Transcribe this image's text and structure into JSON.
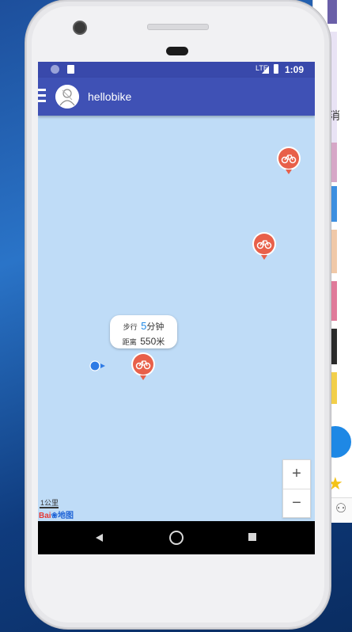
{
  "app": {
    "title": "hellobike"
  },
  "status_bar": {
    "time": "1:09",
    "network": "LTE"
  },
  "map": {
    "marker_icon": "bike-marker-icon",
    "marker_color": "#e8604a",
    "user_location_color": "#2f7be5",
    "popup": {
      "walk_label": "步行",
      "walk_value": "5",
      "walk_unit": "分钟",
      "distance_label": "距离",
      "distance_value": "550",
      "distance_unit": "米"
    },
    "scale_label": "1公里",
    "logo_text_red": "Bai",
    "logo_text_blue": "地图",
    "zoom_in_label": "+",
    "zoom_out_label": "−"
  },
  "colors": {
    "app_bar": "#3f51b5",
    "status_bar": "#3949ab",
    "map_background": "#bfdcf7"
  },
  "background": {
    "side_text": "消"
  }
}
